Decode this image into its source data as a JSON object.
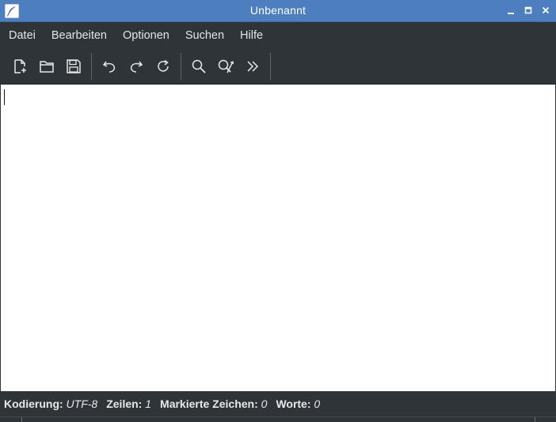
{
  "window": {
    "title": "Unbenannt",
    "app_icon": "feather-pen-icon",
    "controls": [
      "minimize-icon",
      "maximize-icon",
      "close-icon"
    ]
  },
  "menu": {
    "items": [
      "Datei",
      "Bearbeiten",
      "Optionen",
      "Suchen",
      "Hilfe"
    ]
  },
  "toolbar": {
    "buttons": [
      {
        "name": "new-file",
        "icon": "new-file-icon"
      },
      {
        "name": "open-file",
        "icon": "folder-icon"
      },
      {
        "name": "save-file",
        "icon": "floppy-disk-icon"
      },
      {
        "name": "undo",
        "icon": "undo-icon"
      },
      {
        "name": "redo",
        "icon": "redo-icon"
      },
      {
        "name": "reload",
        "icon": "reload-icon"
      },
      {
        "name": "find",
        "icon": "search-icon"
      },
      {
        "name": "replace",
        "icon": "search-replace-icon"
      },
      {
        "name": "jump-to-line",
        "icon": "double-chevron-right-icon"
      }
    ]
  },
  "editor": {
    "content": ""
  },
  "status": {
    "encoding_label": "Kodierung:",
    "encoding_value": "UTF-8",
    "lines_label": "Zeilen:",
    "lines_value": "1",
    "selected_label": "Markierte Zeichen:",
    "selected_value": "0",
    "words_label": "Worte:",
    "words_value": "0"
  },
  "colors": {
    "titlebar": "#4d7fbe",
    "chrome": "#2f3438",
    "editor_bg": "#ffffff",
    "text_light": "#e3e6e8"
  }
}
